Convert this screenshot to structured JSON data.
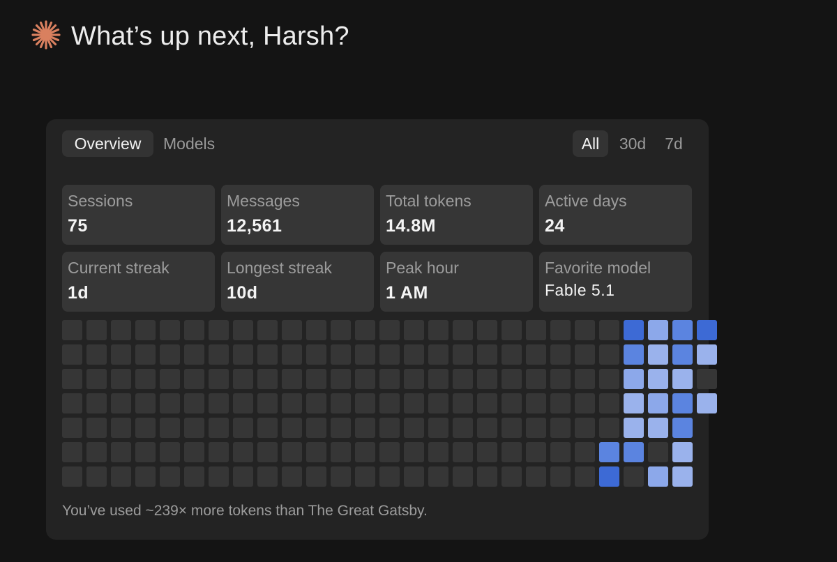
{
  "greeting": {
    "title": "What’s up next, Harsh?",
    "icon": "sparkle-icon",
    "icon_color": "#d9805f"
  },
  "tabs": [
    {
      "label": "Overview",
      "active": true
    },
    {
      "label": "Models",
      "active": false
    }
  ],
  "ranges": [
    {
      "label": "All",
      "active": true
    },
    {
      "label": "30d",
      "active": false
    },
    {
      "label": "7d",
      "active": false
    }
  ],
  "stats": [
    {
      "label": "Sessions",
      "value": "75"
    },
    {
      "label": "Messages",
      "value": "12,561"
    },
    {
      "label": "Total tokens",
      "value": "14.8M"
    },
    {
      "label": "Active days",
      "value": "24"
    },
    {
      "label": "Current streak",
      "value": "1d"
    },
    {
      "label": "Longest streak",
      "value": "10d"
    },
    {
      "label": "Peak hour",
      "value": "1 AM"
    },
    {
      "label": "Favorite model",
      "value": "Fable 5.1"
    }
  ],
  "heatmap": {
    "rows": 7,
    "cols": 26,
    "colors": {
      "0": "#363636",
      "1": "#9ab2ec",
      "2": "#8ca8ea",
      "3": "#5b84e0",
      "4": "#3d6ad5"
    },
    "levels": [
      [
        0,
        0,
        0,
        0,
        0,
        0,
        0,
        0,
        0,
        0,
        0,
        0,
        0,
        0,
        0,
        0,
        0,
        0,
        0,
        0,
        0,
        0,
        0,
        4,
        2,
        3,
        4,
        0
      ],
      [
        0,
        0,
        0,
        0,
        0,
        0,
        0,
        0,
        0,
        0,
        0,
        0,
        0,
        0,
        0,
        0,
        0,
        0,
        0,
        0,
        0,
        0,
        0,
        3,
        1,
        3,
        1,
        0
      ],
      [
        0,
        0,
        0,
        0,
        0,
        0,
        0,
        0,
        0,
        0,
        0,
        0,
        0,
        0,
        0,
        0,
        0,
        0,
        0,
        0,
        0,
        0,
        0,
        2,
        1,
        1,
        0,
        0
      ],
      [
        0,
        0,
        0,
        0,
        0,
        0,
        0,
        0,
        0,
        0,
        0,
        0,
        0,
        0,
        0,
        0,
        0,
        0,
        0,
        0,
        0,
        0,
        0,
        1,
        2,
        3,
        1,
        0
      ],
      [
        0,
        0,
        0,
        0,
        0,
        0,
        0,
        0,
        0,
        0,
        0,
        0,
        0,
        0,
        0,
        0,
        0,
        0,
        0,
        0,
        0,
        0,
        0,
        1,
        1,
        3,
        -1,
        0
      ],
      [
        0,
        0,
        0,
        0,
        0,
        0,
        0,
        0,
        0,
        0,
        0,
        0,
        0,
        0,
        0,
        0,
        0,
        0,
        0,
        0,
        0,
        0,
        3,
        3,
        0,
        1,
        -1,
        0
      ],
      [
        0,
        0,
        0,
        0,
        0,
        0,
        0,
        0,
        0,
        0,
        0,
        0,
        0,
        0,
        0,
        0,
        0,
        0,
        0,
        0,
        0,
        0,
        4,
        0,
        2,
        1,
        -1,
        0
      ]
    ]
  },
  "footnote": "You’ve used ~239× more tokens than The Great Gatsby."
}
